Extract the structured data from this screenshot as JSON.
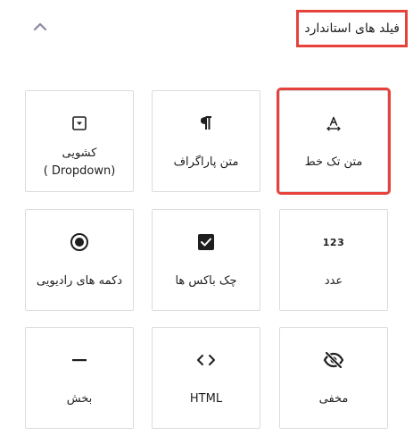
{
  "header": {
    "title": "فیلد های استاندارد"
  },
  "fields": [
    {
      "name": "single-line-text",
      "label": "متن تک خط",
      "icon": "text-field-icon"
    },
    {
      "name": "paragraph-text",
      "label": "متن پاراگراف",
      "icon": "pilcrow-icon"
    },
    {
      "name": "dropdown",
      "label_line1": "کشویی",
      "label_line2": "( Dropdown)",
      "icon": "dropdown-icon"
    },
    {
      "name": "number",
      "label": "عدد",
      "icon": "number-icon",
      "glyph": "123"
    },
    {
      "name": "checkboxes",
      "label": "چک باکس ها",
      "icon": "checkbox-icon"
    },
    {
      "name": "radio-buttons",
      "label": "دکمه های رادیویی",
      "icon": "radio-icon"
    },
    {
      "name": "hidden",
      "label": "مخفی",
      "icon": "eye-slash-icon"
    },
    {
      "name": "html",
      "label": "HTML",
      "icon": "code-icon"
    },
    {
      "name": "section",
      "label": "بخش",
      "icon": "minus-icon"
    }
  ],
  "colors": {
    "highlight": "#e6413a",
    "border": "#dcdcde",
    "icon": "#1e1e1e",
    "chevron": "#8a8aa0"
  }
}
